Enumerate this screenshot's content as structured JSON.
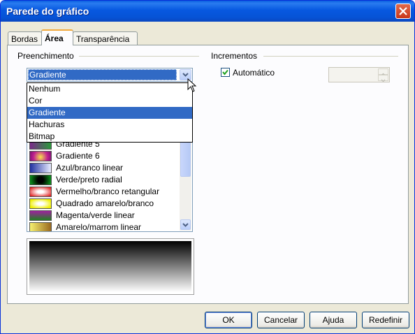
{
  "window": {
    "title": "Parede do gráfico"
  },
  "tabs": [
    {
      "label": "Bordas"
    },
    {
      "label": "Área"
    },
    {
      "label": "Transparência"
    }
  ],
  "fill": {
    "group_label": "Preenchimento",
    "combo_value": "Gradiente",
    "options": [
      "Nenhum",
      "Cor",
      "Gradiente",
      "Hachuras",
      "Bitmap"
    ],
    "gradients": [
      "Gradiente 5",
      "Gradiente 6",
      "Azul/branco linear",
      "Verde/preto radial",
      "Vermelho/branco retangular",
      "Quadrado amarelo/branco",
      "Magenta/verde linear",
      "Amarelo/marrom linear"
    ]
  },
  "increments": {
    "group_label": "Incrementos",
    "auto_label": "Automático",
    "auto_checked": true,
    "value": ""
  },
  "buttons": {
    "ok": "OK",
    "cancel": "Cancelar",
    "help": "Ajuda",
    "reset": "Redefinir"
  },
  "colors": {
    "selection": "#316ac5",
    "titlebar": "#0758e0",
    "tab_highlight": "#f1a93c"
  }
}
